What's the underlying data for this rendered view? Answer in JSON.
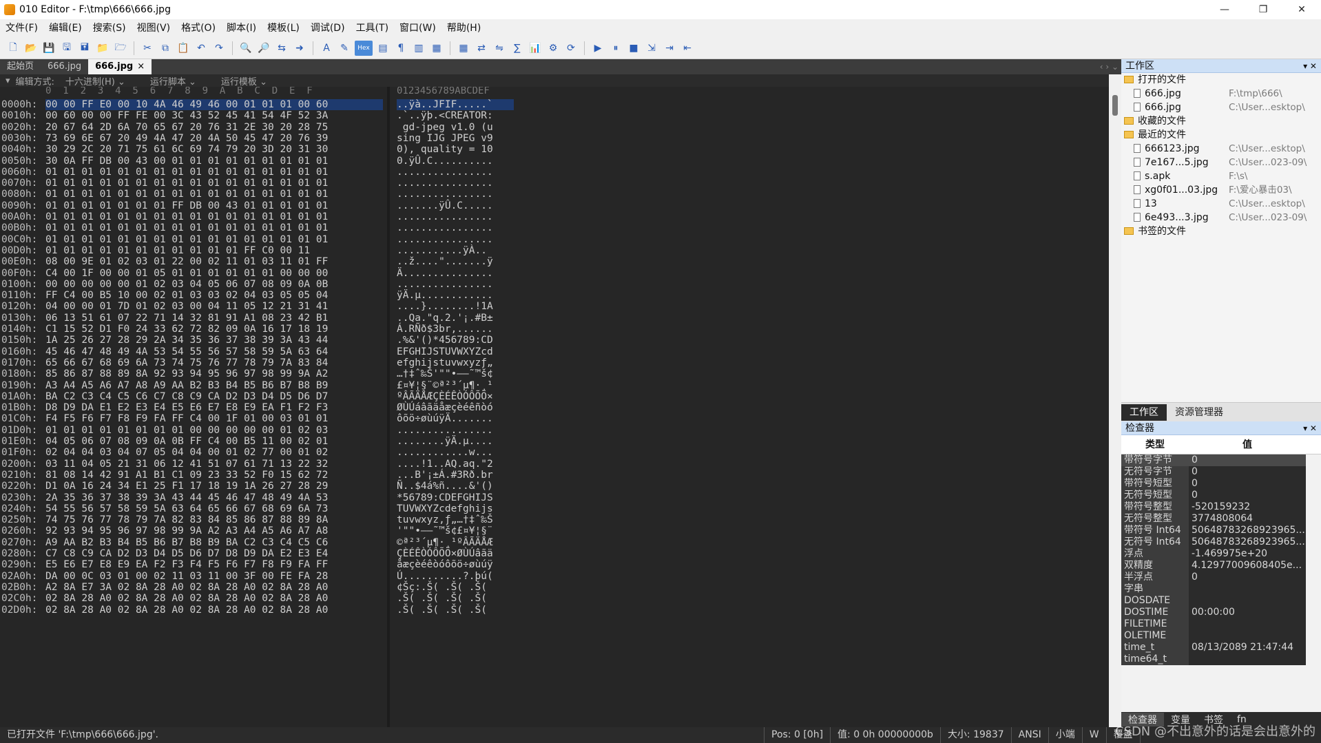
{
  "window": {
    "title": "010 Editor - F:\\tmp\\666\\666.jpg",
    "minimize": "—",
    "restore": "❐",
    "close": "✕"
  },
  "menu": [
    "文件(F)",
    "编辑(E)",
    "搜索(S)",
    "视图(V)",
    "格式(O)",
    "脚本(I)",
    "模板(L)",
    "调试(D)",
    "工具(T)",
    "窗口(W)",
    "帮助(H)"
  ],
  "tabs": [
    {
      "label": "起始页"
    },
    {
      "label": "666.jpg"
    },
    {
      "label": "666.jpg",
      "active": true,
      "close": "×"
    }
  ],
  "tab_nav": "‹ › ⌄",
  "editor_head": {
    "collapse": "▾",
    "mode_label": "编辑方式:",
    "mode_value": "十六进制(H)",
    "run_script": "运行脚本",
    "run_template": "运行模板"
  },
  "hex_header": {
    "cols": "0  1  2  3  4  5  6  7  8  9  A  B  C  D  E  F",
    "ascii": "0123456789ABCDEF"
  },
  "hex_rows": [
    {
      "off": "0000h:",
      "bytes": "00 00 FF E0 00 10 4A 46 49 46 00 01 01 01 00 60",
      "ascii": "..ÿà..JFIF.....`"
    },
    {
      "off": "0010h:",
      "bytes": "00 60 00 00 FF FE 00 3C 43 52 45 41 54 4F 52 3A",
      "ascii": ".`..ÿþ.<CREATOR:"
    },
    {
      "off": "0020h:",
      "bytes": "20 67 64 2D 6A 70 65 67 20 76 31 2E 30 20 28 75",
      "ascii": " gd-jpeg v1.0 (u"
    },
    {
      "off": "0030h:",
      "bytes": "73 69 6E 67 20 49 4A 47 20 4A 50 45 47 20 76 39",
      "ascii": "sing IJG JPEG v9"
    },
    {
      "off": "0040h:",
      "bytes": "30 29 2C 20 71 75 61 6C 69 74 79 20 3D 20 31 30",
      "ascii": "0), quality = 10"
    },
    {
      "off": "0050h:",
      "bytes": "30 0A FF DB 00 43 00 01 01 01 01 01 01 01 01 01",
      "ascii": "0.ÿÛ.C.........."
    },
    {
      "off": "0060h:",
      "bytes": "01 01 01 01 01 01 01 01 01 01 01 01 01 01 01 01",
      "ascii": "................"
    },
    {
      "off": "0070h:",
      "bytes": "01 01 01 01 01 01 01 01 01 01 01 01 01 01 01 01",
      "ascii": "................"
    },
    {
      "off": "0080h:",
      "bytes": "01 01 01 01 01 01 01 01 01 01 01 01 01 01 01 01",
      "ascii": "................"
    },
    {
      "off": "0090h:",
      "bytes": "01 01 01 01 01 01 01 FF DB 00 43 01 01 01 01 01",
      "ascii": ".......ÿÛ.C....."
    },
    {
      "off": "00A0h:",
      "bytes": "01 01 01 01 01 01 01 01 01 01 01 01 01 01 01 01",
      "ascii": "................"
    },
    {
      "off": "00B0h:",
      "bytes": "01 01 01 01 01 01 01 01 01 01 01 01 01 01 01 01",
      "ascii": "................"
    },
    {
      "off": "00C0h:",
      "bytes": "01 01 01 01 01 01 01 01 01 01 01 01 01 01 01 01",
      "ascii": "................"
    },
    {
      "off": "00D0h:",
      "bytes": "01 01 01 01 01 01 01 01 01 01 01 FF C0 00 11",
      "ascii": "...........ÿÀ.."
    },
    {
      "off": "00E0h:",
      "bytes": "08 00 9E 01 02 03 01 22 00 02 11 01 03 11 01 FF",
      "ascii": "..ž....\".......ÿ"
    },
    {
      "off": "00F0h:",
      "bytes": "C4 00 1F 00 00 01 05 01 01 01 01 01 01 00 00 00",
      "ascii": "Ä..............."
    },
    {
      "off": "0100h:",
      "bytes": "00 00 00 00 00 01 02 03 04 05 06 07 08 09 0A 0B",
      "ascii": "................"
    },
    {
      "off": "0110h:",
      "bytes": "FF C4 00 B5 10 00 02 01 03 03 02 04 03 05 05 04",
      "ascii": "ÿÄ.µ............"
    },
    {
      "off": "0120h:",
      "bytes": "04 00 00 01 7D 01 02 03 00 04 11 05 12 21 31 41",
      "ascii": "....}........!1A"
    },
    {
      "off": "0130h:",
      "bytes": "06 13 51 61 07 22 71 14 32 81 91 A1 08 23 42 B1",
      "ascii": "..Qa.\"q.2.'¡.#B±"
    },
    {
      "off": "0140h:",
      "bytes": "C1 15 52 D1 F0 24 33 62 72 82 09 0A 16 17 18 19",
      "ascii": "Á.RÑð$3br,......"
    },
    {
      "off": "0150h:",
      "bytes": "1A 25 26 27 28 29 2A 34 35 36 37 38 39 3A 43 44",
      "ascii": ".%&'()*456789:CD"
    },
    {
      "off": "0160h:",
      "bytes": "45 46 47 48 49 4A 53 54 55 56 57 58 59 5A 63 64",
      "ascii": "EFGHIJSTUVWXYZcd"
    },
    {
      "off": "0170h:",
      "bytes": "65 66 67 68 69 6A 73 74 75 76 77 78 79 7A 83 84",
      "ascii": "efghijstuvwxyzƒ„"
    },
    {
      "off": "0180h:",
      "bytes": "85 86 87 88 89 8A 92 93 94 95 96 97 98 99 9A A2",
      "ascii": "…†‡ˆ‰Š'\"\"•–—˜™š¢"
    },
    {
      "off": "0190h:",
      "bytes": "A3 A4 A5 A6 A7 A8 A9 AA B2 B3 B4 B5 B6 B7 B8 B9",
      "ascii": "£¤¥¦§¨©ª²³´µ¶·¸¹"
    },
    {
      "off": "01A0h:",
      "bytes": "BA C2 C3 C4 C5 C6 C7 C8 C9 CA D2 D3 D4 D5 D6 D7",
      "ascii": "ºÂÃÄÅÆÇÈÉÊÒÓÔÕÖ×"
    },
    {
      "off": "01B0h:",
      "bytes": "D8 D9 DA E1 E2 E3 E4 E5 E6 E7 E8 E9 EA F1 F2 F3",
      "ascii": "ØÙÚáâãäåæçèéêñòó"
    },
    {
      "off": "01C0h:",
      "bytes": "F4 F5 F6 F7 F8 F9 FA FF C4 00 1F 01 00 03 01 01",
      "ascii": "ôõö÷øùúÿÄ......."
    },
    {
      "off": "01D0h:",
      "bytes": "01 01 01 01 01 01 01 01 00 00 00 00 00 01 02 03",
      "ascii": "................"
    },
    {
      "off": "01E0h:",
      "bytes": "04 05 06 07 08 09 0A 0B FF C4 00 B5 11 00 02 01",
      "ascii": "........ÿÄ.µ...."
    },
    {
      "off": "01F0h:",
      "bytes": "02 04 04 03 04 07 05 04 04 00 01 02 77 00 01 02",
      "ascii": "............w..."
    },
    {
      "off": "0200h:",
      "bytes": "03 11 04 05 21 31 06 12 41 51 07 61 71 13 22 32",
      "ascii": "....!1..AQ.aq.\"2"
    },
    {
      "off": "0210h:",
      "bytes": "81 08 14 42 91 A1 B1 C1 09 23 33 52 F0 15 62 72",
      "ascii": "...B'¡±Á.#3Rð.br"
    },
    {
      "off": "0220h:",
      "bytes": "D1 0A 16 24 34 E1 25 F1 17 18 19 1A 26 27 28 29",
      "ascii": "Ñ..$4á%ñ....&'()"
    },
    {
      "off": "0230h:",
      "bytes": "2A 35 36 37 38 39 3A 43 44 45 46 47 48 49 4A 53",
      "ascii": "*56789:CDEFGHIJS"
    },
    {
      "off": "0240h:",
      "bytes": "54 55 56 57 58 59 5A 63 64 65 66 67 68 69 6A 73",
      "ascii": "TUVWXYZcdefghijs"
    },
    {
      "off": "0250h:",
      "bytes": "74 75 76 77 78 79 7A 82 83 84 85 86 87 88 89 8A",
      "ascii": "tuvwxyz‚ƒ„…†‡ˆ‰Š"
    },
    {
      "off": "0260h:",
      "bytes": "92 93 94 95 96 97 98 99 9A A2 A3 A4 A5 A6 A7 A8",
      "ascii": "'\"\"•–—˜™š¢£¤¥¦§¨"
    },
    {
      "off": "0270h:",
      "bytes": "A9 AA B2 B3 B4 B5 B6 B7 B8 B9 BA C2 C3 C4 C5 C6",
      "ascii": "©ª²³´µ¶·¸¹ºÂÃÄÅÆ"
    },
    {
      "off": "0280h:",
      "bytes": "C7 C8 C9 CA D2 D3 D4 D5 D6 D7 D8 D9 DA E2 E3 E4",
      "ascii": "ÇÈÉÊÒÓÔÕÖ×ØÙÚâãä"
    },
    {
      "off": "0290h:",
      "bytes": "E5 E6 E7 E8 E9 EA F2 F3 F4 F5 F6 F7 F8 F9 FA FF",
      "ascii": "åæçèéêòóôõö÷øùúÿ"
    },
    {
      "off": "02A0h:",
      "bytes": "DA 00 0C 03 01 00 02 11 03 11 00 3F 00 FE FA 28",
      "ascii": "Ú..........?.þú("
    },
    {
      "off": "02B0h:",
      "bytes": "A2 8A E7 3A 02 8A 28 A0 02 8A 28 A0 02 8A 28 A0",
      "ascii": "¢Šç:.Š( .Š( .Š( "
    },
    {
      "off": "02C0h:",
      "bytes": "02 8A 28 A0 02 8A 28 A0 02 8A 28 A0 02 8A 28 A0",
      "ascii": ".Š( .Š( .Š( .Š( "
    },
    {
      "off": "02D0h:",
      "bytes": "02 8A 28 A0 02 8A 28 A0 02 8A 28 A0 02 8A 28 A0",
      "ascii": ".Š( .Š( .Š( .Š( "
    }
  ],
  "workspace": {
    "title": "工作区",
    "title_ctl": "▾ ✕",
    "items": [
      {
        "kind": "folder",
        "label": "打开的文件",
        "path": ""
      },
      {
        "kind": "file",
        "label": "666.jpg",
        "path": "F:\\tmp\\666\\"
      },
      {
        "kind": "file",
        "label": "666.jpg",
        "path": "C:\\User...esktop\\"
      },
      {
        "kind": "folder",
        "label": "收藏的文件",
        "path": ""
      },
      {
        "kind": "folder",
        "label": "最近的文件",
        "path": ""
      },
      {
        "kind": "file",
        "label": "666123.jpg",
        "path": "C:\\User...esktop\\"
      },
      {
        "kind": "file",
        "label": "7e167...5.jpg",
        "path": "C:\\User...023-09\\"
      },
      {
        "kind": "file",
        "label": "s.apk",
        "path": "F:\\s\\"
      },
      {
        "kind": "file",
        "label": "xg0f01...03.jpg",
        "path": "F:\\爱心暴击03\\"
      },
      {
        "kind": "file",
        "label": "13",
        "path": "C:\\User...esktop\\"
      },
      {
        "kind": "file",
        "label": "6e493...3.jpg",
        "path": "C:\\User...023-09\\"
      },
      {
        "kind": "folder",
        "label": "书签的文件",
        "path": ""
      }
    ],
    "tabs": [
      "工作区",
      "资源管理器"
    ]
  },
  "inspector": {
    "title": "检查器",
    "title_ctl": "▾ ✕",
    "col_type": "类型",
    "col_value": "值",
    "rows": [
      {
        "k": "带符号字节",
        "v": "0"
      },
      {
        "k": "无符号字节",
        "v": "0"
      },
      {
        "k": "带符号短型",
        "v": "0"
      },
      {
        "k": "无符号短型",
        "v": "0"
      },
      {
        "k": "带符号整型",
        "v": "-520159232"
      },
      {
        "k": "无符号整型",
        "v": "3774808064"
      },
      {
        "k": "带符号 Int64",
        "v": "50648783268923965..."
      },
      {
        "k": "无符号 Int64",
        "v": "50648783268923965..."
      },
      {
        "k": "浮点",
        "v": "-1.469975e+20"
      },
      {
        "k": "双精度",
        "v": "4.12977009608405e..."
      },
      {
        "k": "半浮点",
        "v": "0"
      },
      {
        "k": "字串",
        "v": ""
      },
      {
        "k": "DOSDATE",
        "v": ""
      },
      {
        "k": "DOSTIME",
        "v": "00:00:00"
      },
      {
        "k": "FILETIME",
        "v": ""
      },
      {
        "k": "OLETIME",
        "v": ""
      },
      {
        "k": "time_t",
        "v": "08/13/2089 21:47:44"
      },
      {
        "k": "time64_t",
        "v": ""
      }
    ],
    "bottom_tabs": [
      "检查器",
      "变量",
      "书签",
      "fn"
    ]
  },
  "status": {
    "message": "已打开文件 'F:\\tmp\\666\\666.jpg'.",
    "pos": "Pos: 0 [0h]",
    "value": "值: 0 0h 00000000b",
    "size": "大小: 19837",
    "enc": "ANSI",
    "endian": "小端",
    "mode": "W",
    "ovr": "覆盖"
  },
  "watermark": "CSDN @不出意外的话是会出意外的",
  "colors": {
    "accent": "#cde0f6",
    "highlight": "#1e3a6e",
    "bg": "#262626"
  }
}
